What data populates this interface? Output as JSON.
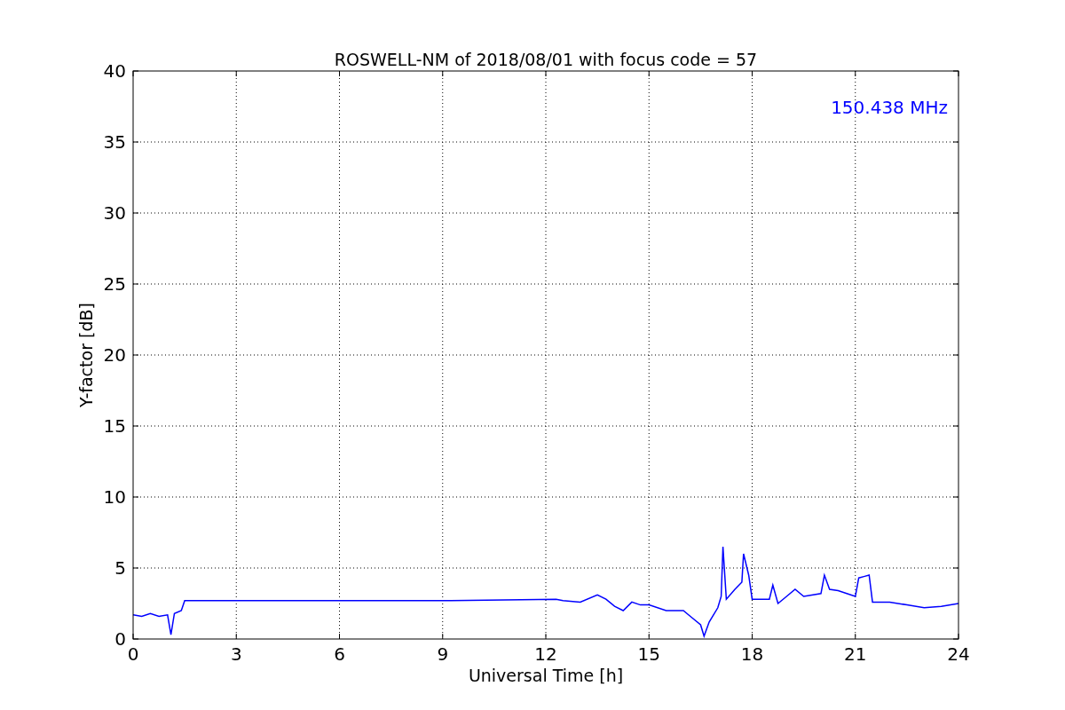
{
  "chart_data": {
    "type": "line",
    "title": "ROSWELL-NM of 2018/08/01 with focus code = 57",
    "xlabel": "Universal Time [h]",
    "ylabel": "Y-factor [dB]",
    "x": [
      0,
      0.25,
      0.5,
      0.75,
      1,
      1.1,
      1.2,
      1.4,
      1.5,
      3,
      6,
      9,
      12.3,
      12.5,
      13,
      13.5,
      13.75,
      14,
      14.25,
      14.5,
      14.75,
      15,
      15.5,
      16,
      16.25,
      16.5,
      16.6,
      16.75,
      17,
      17.1,
      17.15,
      17.25,
      17.5,
      17.7,
      17.75,
      17.9,
      18,
      18.5,
      18.6,
      18.75,
      19,
      19.25,
      19.5,
      20,
      20.1,
      20.25,
      20.5,
      21,
      21.1,
      21.25,
      21.4,
      21.5,
      22,
      22.5,
      23,
      23.5,
      24
    ],
    "series": [
      {
        "name": "150.438 MHz",
        "color": "#0000ff",
        "values": [
          1.7,
          1.6,
          1.8,
          1.6,
          1.7,
          0.3,
          1.8,
          2.0,
          2.7,
          2.7,
          2.7,
          2.7,
          2.8,
          2.7,
          2.6,
          3.1,
          2.8,
          2.3,
          2.0,
          2.6,
          2.4,
          2.4,
          2.0,
          2.0,
          1.5,
          1.0,
          0.2,
          1.2,
          2.2,
          3.0,
          6.5,
          2.8,
          3.5,
          4.0,
          6.0,
          4.5,
          2.8,
          2.8,
          3.8,
          2.5,
          3.0,
          3.5,
          3.0,
          3.2,
          4.5,
          3.5,
          3.4,
          3.0,
          4.3,
          4.4,
          4.5,
          2.6,
          2.6,
          2.4,
          2.2,
          2.3,
          2.5
        ]
      }
    ],
    "xlim": [
      0,
      24
    ],
    "ylim": [
      0,
      40
    ],
    "xticks": [
      0,
      3,
      6,
      9,
      12,
      15,
      18,
      21,
      24
    ],
    "yticks": [
      0,
      5,
      10,
      15,
      20,
      25,
      30,
      35,
      40
    ],
    "grid": true
  }
}
